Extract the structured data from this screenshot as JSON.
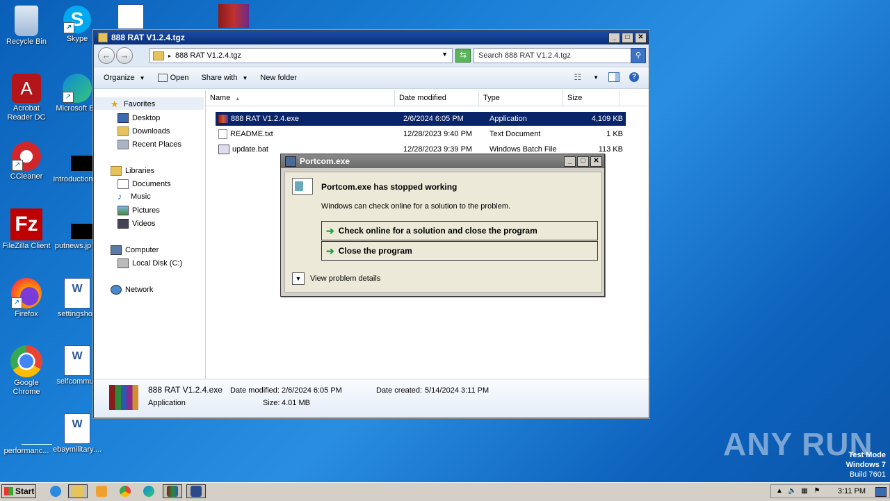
{
  "desktop": {
    "icons": [
      {
        "label": "Recycle Bin",
        "icon": "recycle-bin-icon"
      },
      {
        "label": "Skype",
        "icon": "skype-icon"
      },
      {
        "label": "Acrobat Reader DC",
        "icon": "acrobat-icon"
      },
      {
        "label": "Microsoft Ed",
        "icon": "edge-icon"
      },
      {
        "label": "CCleaner",
        "icon": "ccleaner-icon"
      },
      {
        "label": "introduction",
        "icon": "black-file-icon"
      },
      {
        "label": "FileZilla Client",
        "icon": "filezilla-icon"
      },
      {
        "label": "putnews.jp",
        "icon": "black-file-icon"
      },
      {
        "label": "Firefox",
        "icon": "firefox-icon"
      },
      {
        "label": "settingshou",
        "icon": "word-doc-icon"
      },
      {
        "label": "Google Chrome",
        "icon": "chrome-icon"
      },
      {
        "label": "selfcommun",
        "icon": "word-doc-icon"
      },
      {
        "label": "performanc...",
        "icon": "blank-file-icon"
      },
      {
        "label": "ebaymilitary....",
        "icon": "word-doc-icon"
      }
    ]
  },
  "explorer": {
    "title": "888 RAT V1.2.4.tgz",
    "address": "888 RAT V1.2.4.tgz",
    "search_placeholder": "Search 888 RAT V1.2.4.tgz",
    "toolbar": {
      "organize": "Organize",
      "open": "Open",
      "share_with": "Share with",
      "new_folder": "New folder"
    },
    "nav": {
      "favorites": "Favorites",
      "desktop": "Desktop",
      "downloads": "Downloads",
      "recent_places": "Recent Places",
      "libraries": "Libraries",
      "documents": "Documents",
      "music": "Music",
      "pictures": "Pictures",
      "videos": "Videos",
      "computer": "Computer",
      "local_disk": "Local Disk (C:)",
      "network": "Network"
    },
    "columns": {
      "name": "Name",
      "date_modified": "Date modified",
      "type": "Type",
      "size": "Size"
    },
    "files": [
      {
        "name": "888 RAT V1.2.4.exe",
        "date": "2/6/2024 6:05 PM",
        "type": "Application",
        "size": "4,109 KB"
      },
      {
        "name": "README.txt",
        "date": "12/28/2023 9:40 PM",
        "type": "Text Document",
        "size": "1 KB"
      },
      {
        "name": "update.bat",
        "date": "12/28/2023 9:39 PM",
        "type": "Windows Batch File",
        "size": "113 KB"
      }
    ],
    "details": {
      "name": "888 RAT V1.2.4.exe",
      "date_modified_label": "Date modified:",
      "date_modified": "2/6/2024 6:05 PM",
      "date_created_label": "Date created:",
      "date_created": "5/14/2024 3:11 PM",
      "type": "Application",
      "size_label": "Size:",
      "size": "4.01 MB"
    }
  },
  "dialog": {
    "title": "Portcom.exe",
    "heading": "Portcom.exe has stopped working",
    "subtext": "Windows can check online for a solution to the problem.",
    "option1": "Check online for a solution and close the program",
    "option2": "Close the program",
    "details": "View problem details"
  },
  "taskbar": {
    "start": "Start",
    "clock": "3:11 PM"
  },
  "watermark": {
    "text": "ANY RUN",
    "test_mode": "Test Mode",
    "os": "Windows 7",
    "build": "Build 7601"
  },
  "colors": {
    "desktop_bg": "#1a7fd6",
    "selection": "#0a246a",
    "titlebar": "#0a2f7a",
    "green_arrow": "#1aa33a"
  }
}
